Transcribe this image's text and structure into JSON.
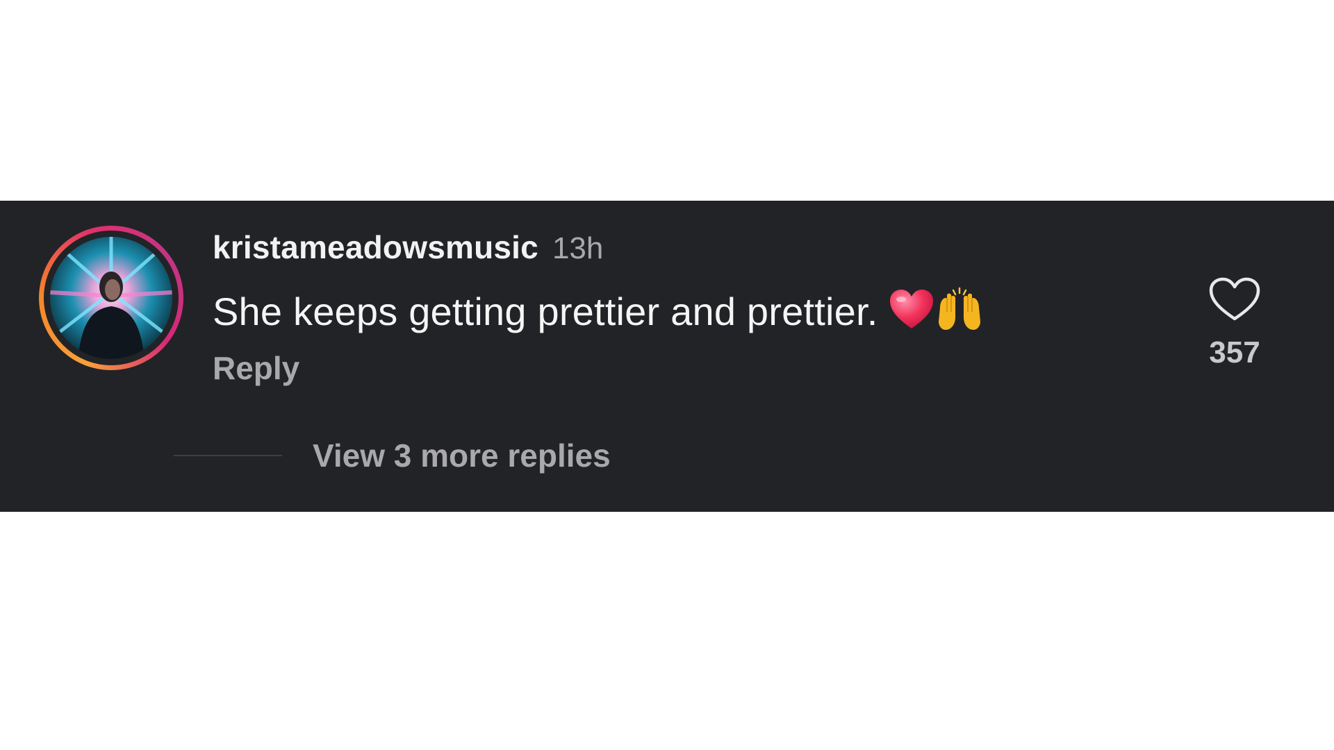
{
  "comment": {
    "username": "kristameadowsmusic",
    "time": "13h",
    "text": "She keeps getting prettier and prettier.",
    "emojis": [
      "red-heart-emoji",
      "raising-hands-emoji"
    ],
    "reply_label": "Reply",
    "like_icon": "heart-outline-icon",
    "like_count": "357",
    "view_replies_label": "View 3 more replies"
  },
  "colors": {
    "background": "#222327",
    "text_primary": "#f2f2f2",
    "text_secondary": "#a8a8ad",
    "story_ring": [
      "#f9a13a",
      "#e1306c",
      "#c13584"
    ]
  }
}
